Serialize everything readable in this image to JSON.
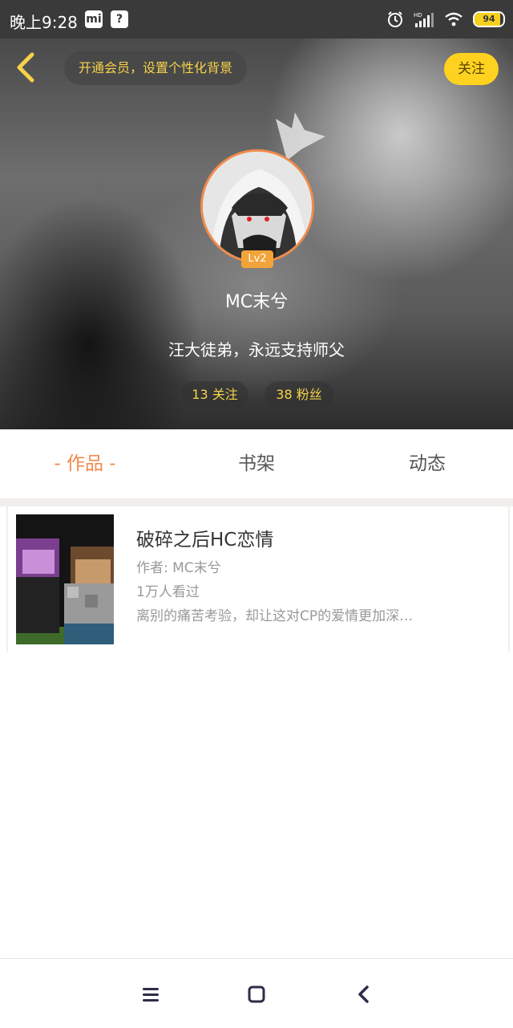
{
  "status_bar": {
    "time": "晚上9:28",
    "mi_icon": "mi-app-icon",
    "unknown_icon": "?",
    "battery": "94"
  },
  "header": {
    "vip_banner": "开通会员，设置个性化背景",
    "follow_label": "关注"
  },
  "profile": {
    "name": "MC末兮",
    "level": "Lv2",
    "bio": "汪大徒弟，永远支持师父",
    "following": "13 关注",
    "followers": "38 粉丝"
  },
  "tabs": [
    {
      "label": "- 作品 -",
      "active": true
    },
    {
      "label": "书架",
      "active": false
    },
    {
      "label": "动态",
      "active": false
    }
  ],
  "works": [
    {
      "title": "破碎之后HC恋情",
      "author": "作者: MC末兮",
      "views": "1万人看过",
      "description": "离别的痛苦考验，却让这对CP的爱情更加深…"
    }
  ],
  "colors": {
    "accent": "#f08a4b",
    "yellow": "#ffd21f",
    "gold_text": "#f6d24a"
  },
  "nav_icons": [
    "menu-icon",
    "home-icon",
    "back-icon"
  ]
}
